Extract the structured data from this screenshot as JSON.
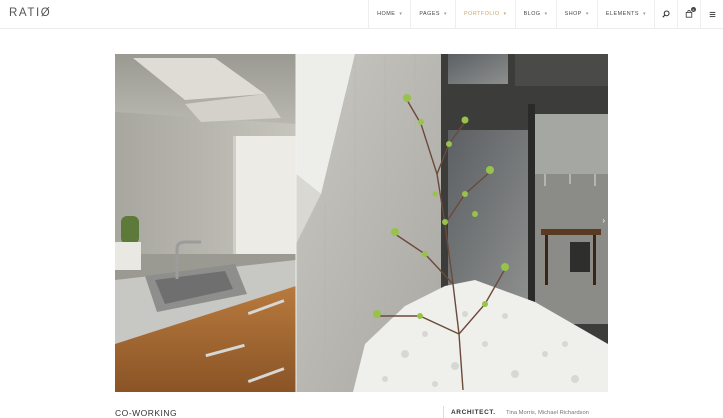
{
  "header": {
    "logo": "RATIØ",
    "nav": [
      {
        "label": "HOME",
        "active": false
      },
      {
        "label": "PAGES",
        "active": false
      },
      {
        "label": "PORTFOLIO",
        "active": true
      },
      {
        "label": "BLOG",
        "active": false
      },
      {
        "label": "SHOP",
        "active": false
      },
      {
        "label": "ELEMENTS",
        "active": false
      }
    ],
    "icons": [
      "search-icon",
      "cart-icon",
      "menu-icon"
    ],
    "cart_count": "0",
    "accent_color": "#c9a66b"
  },
  "gallery": {
    "next_arrow_icon": "chevron-right-icon"
  },
  "project": {
    "title": "CO-WORKING",
    "meta_label": "ARCHITECT.",
    "meta_value": "Tina Morris, Michael Richardson"
  }
}
